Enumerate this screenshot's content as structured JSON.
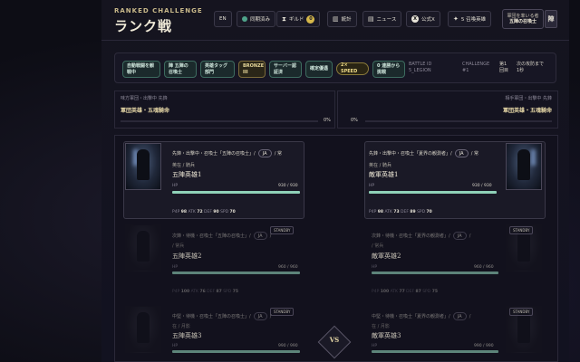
{
  "header": {
    "eyebrow": "RANKED CHALLENGE",
    "title": "ランク戦",
    "lang": "EN",
    "sync": "同期済み",
    "guild": "ギルド",
    "guild_count": "0",
    "ranking": "統計",
    "news": "ニュース",
    "official_x": "公式X",
    "summoner": "5 召喚英雄",
    "leader_line1": "軍団を率いる者",
    "leader_line2": "五陣の召喚士",
    "leader_badge": "陣"
  },
  "status": {
    "chip1": "自動戦闘を観戦中",
    "chip2": "陣 五陣の召喚士",
    "chip3": "英雄タッグ部門",
    "chip4": "BRONZE III",
    "chip5": "サーバー認証済",
    "chip6": "確定優遇",
    "speed": "2× SPEED",
    "chip8": "0 連勝から挑戦",
    "battle_id_label": "BATTLE ID",
    "battle_id": "5_LEGION",
    "challenge_label": "CHALLENGE",
    "challenge": "#1",
    "round_label": "第1",
    "round": "回目",
    "next_label": "次の攻防まで",
    "next": "1秒"
  },
  "teams": {
    "ally_label": "味方軍団・出撃中 先鋒",
    "ally_name": "軍団英雄・五魂騎命",
    "ally_pct": "0%",
    "enemy_label": "相手軍団・出撃中 先鋒",
    "enemy_name": "軍団英雄・五魂騎命",
    "enemy_pct": "0%"
  },
  "cards": {
    "ally": [
      {
        "line1a": "先鋒・出撃中・召喚士「五陣の召喚士」/",
        "lang": "JA",
        "line1b": "/ 常",
        "role": "英在 / 騎兵",
        "name": "五陣英雄1",
        "hp_label": "HP",
        "hp": "930 / 930",
        "hp_frac": 1.0,
        "stats": [
          "P4P",
          "98",
          "ATK",
          "72",
          "DEF",
          "90",
          "SPD",
          "70"
        ]
      },
      {
        "line1a": "次鋒・待機・召喚士「五陣の召喚士」/",
        "lang": "JA",
        "line1b": "/",
        "role": "/ 常兵",
        "name": "五陣英雄2",
        "hp_label": "HP",
        "hp": "960 / 960",
        "hp_frac": 1.0,
        "stats": [
          "P4P",
          "100",
          "ATK",
          "76",
          "DEF",
          "87",
          "SPD",
          "75"
        ],
        "standby": "STANDBY"
      },
      {
        "line1a": "中堅・待機・召喚士「五陣の召喚士」/",
        "lang": "JA",
        "line1b": "/",
        "role": "在 / 月影",
        "name": "五陣英雄3",
        "hp_label": "HP",
        "hp": "990 / 990",
        "hp_frac": 1.0,
        "standby": "STANDBY"
      }
    ],
    "enemy": [
      {
        "line1a": "先鋒・出撃中・召喚士「夏界の観測者」/",
        "lang": "JA",
        "line1b": "/ 常",
        "role": "英在 / 騎兵",
        "name": "敵軍英雄1",
        "hp_label": "HP",
        "hp": "930 / 930",
        "hp_frac": 1.0,
        "stats": [
          "P4P",
          "98",
          "ATK",
          "73",
          "DEF",
          "89",
          "SPD",
          "70"
        ]
      },
      {
        "line1a": "次鋒・待機・召喚士「夏界の観測者」/",
        "lang": "JA",
        "line1b": "/",
        "role": "/ 常兵",
        "name": "敵軍英雄2",
        "hp_label": "HP",
        "hp": "960 / 960",
        "hp_frac": 1.0,
        "stats": [
          "P4P",
          "100",
          "ATK",
          "77",
          "DEF",
          "87",
          "SPD",
          "75"
        ],
        "standby": "STANDBY"
      },
      {
        "line1a": "中堅・待機・召喚士「夏界の観測者」/",
        "lang": "JA",
        "line1b": "/",
        "role": "在 / 月影",
        "name": "敵軍英雄3",
        "hp_label": "HP",
        "hp": "990 / 990",
        "hp_frac": 1.0,
        "standby": "STANDBY"
      }
    ]
  },
  "vs": "VS",
  "colors": {
    "hp_bar": "#8fd1b8",
    "accent_gold": "#e8d9a8",
    "chip_green": "#3d6b5f"
  }
}
